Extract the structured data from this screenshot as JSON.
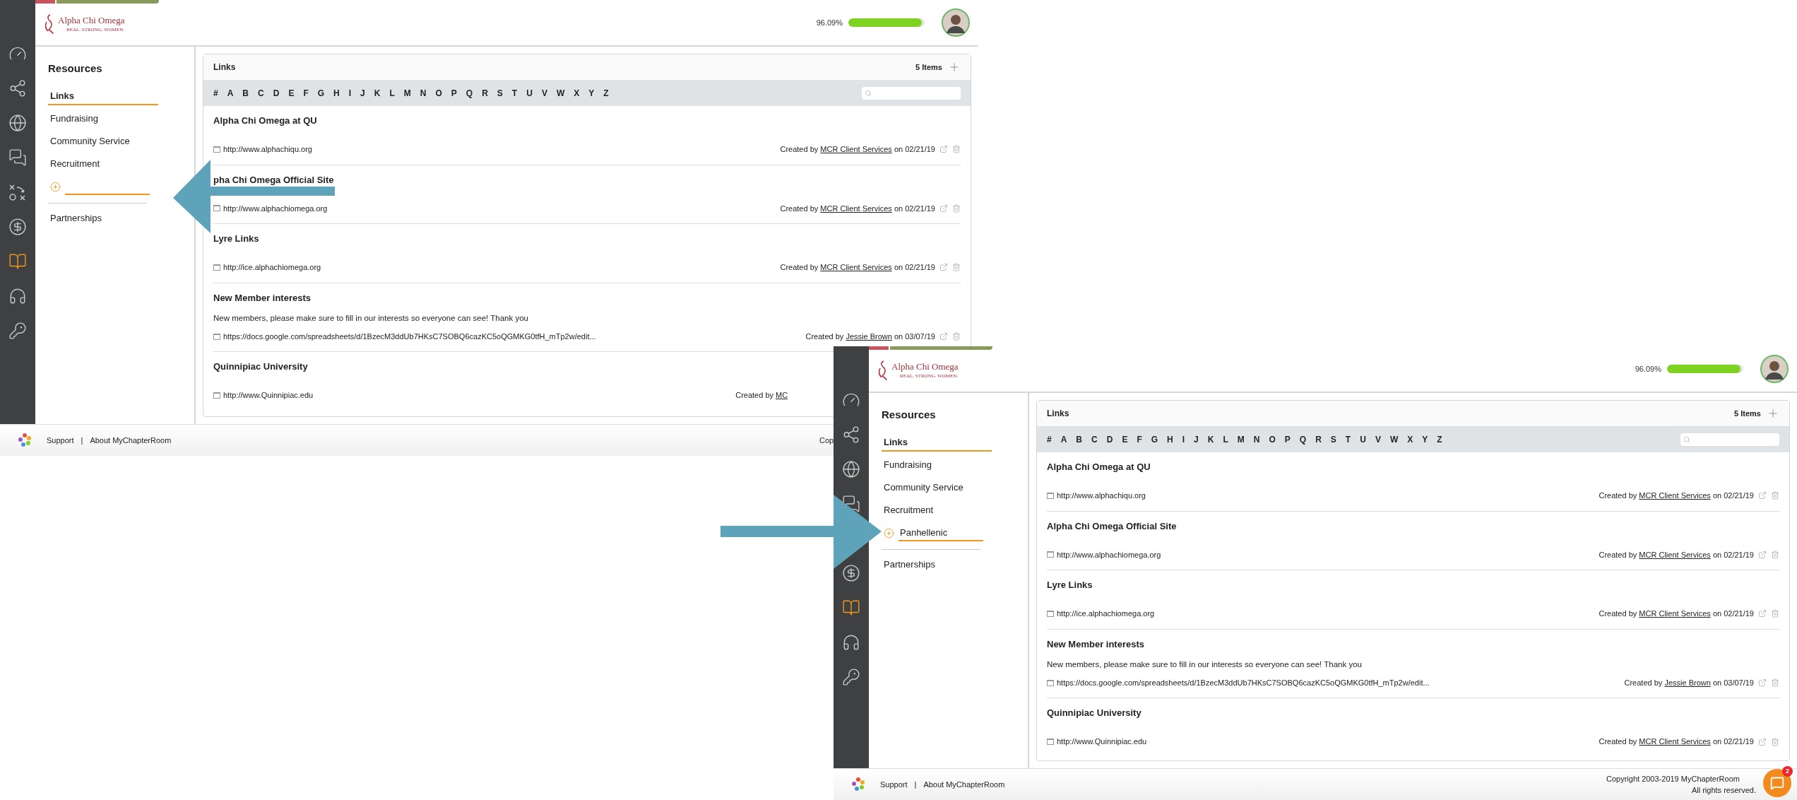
{
  "screens": [
    {
      "logo": {
        "name": "Alpha Chi Omega",
        "tagline": "REAL. STRONG. WOMEN."
      },
      "progress": {
        "reading": "96.09%",
        "level": 0.96
      },
      "nav": {
        "title": "Resources",
        "items": [
          {
            "kind": "item",
            "label": "Links",
            "selected": true
          },
          {
            "kind": "item",
            "label": "Fundraising",
            "selected": false
          },
          {
            "kind": "item",
            "label": "Community Service",
            "selected": false
          },
          {
            "kind": "item",
            "label": "Recruitment",
            "selected": false
          },
          {
            "kind": "input"
          },
          {
            "kind": "divider"
          },
          {
            "kind": "item",
            "label": "Partnerships",
            "selected": false
          }
        ]
      },
      "links": {
        "title": "Links",
        "count": "5 Items",
        "letters": [
          "#",
          "A",
          "B",
          "C",
          "D",
          "E",
          "F",
          "G",
          "H",
          "I",
          "J",
          "K",
          "L",
          "M",
          "N",
          "O",
          "P",
          "Q",
          "R",
          "S",
          "T",
          "U",
          "V",
          "W",
          "X",
          "Y",
          "Z"
        ],
        "rows": [
          {
            "title": "Alpha Chi Omega at QU",
            "url": "http://www.alphachiqu.org",
            "created": "Created by",
            "author": "MCR Client Services",
            "date": "on 02/21/19"
          },
          {
            "title": "pha Chi Omega Official Site",
            "url": "http://www.alphachiomega.org",
            "created": "Created by",
            "author": "MCR Client Services",
            "date": "on 02/21/19"
          },
          {
            "title": "Lyre Links",
            "url": "http://ice.alphachiomega.org",
            "created": "Created by",
            "author": "MCR Client Services",
            "date": "on 02/21/19"
          },
          {
            "title": "New Member interests",
            "description": "New members, please make sure to fill in our interests so everyone can see! Thank you",
            "url": "https://docs.google.com/spreadsheets/d/1BzecM3ddUb7HKsC7SOBQ6cazKC5oQGMKG0tfH_mTp2w/edit...",
            "created": "Created by",
            "author": "Jessie Brown",
            "date": "on 03/07/19"
          },
          {
            "title": "Quinnipiac University",
            "url": "http://www.Quinnipiac.edu",
            "created": "Created by",
            "author": "MC"
          }
        ]
      },
      "footer": {
        "links": [
          "Support",
          "About MyChapterRoom"
        ],
        "separator": "|",
        "copyright": [
          "Cop"
        ]
      }
    },
    {
      "logo": {
        "name": "Alpha Chi Omega",
        "tagline": "REAL. STRONG. WOMEN."
      },
      "progress": {
        "reading": "96.09%",
        "level": 0.96
      },
      "nav": {
        "title": "Resources",
        "items": [
          {
            "kind": "item",
            "label": "Links",
            "selected": true
          },
          {
            "kind": "item",
            "label": "Fundraising",
            "selected": false
          },
          {
            "kind": "item",
            "label": "Community Service",
            "selected": false
          },
          {
            "kind": "item",
            "label": "Recruitment",
            "selected": false
          },
          {
            "kind": "input",
            "value": "Panhellenic"
          },
          {
            "kind": "divider"
          },
          {
            "kind": "item",
            "label": "Partnerships",
            "selected": false
          }
        ]
      },
      "links": {
        "title": "Links",
        "count": "5 Items",
        "letters": [
          "#",
          "A",
          "B",
          "C",
          "D",
          "E",
          "F",
          "G",
          "H",
          "I",
          "J",
          "K",
          "L",
          "M",
          "N",
          "O",
          "P",
          "Q",
          "R",
          "S",
          "T",
          "U",
          "V",
          "W",
          "X",
          "Y",
          "Z"
        ],
        "rows": [
          {
            "title": "Alpha Chi Omega at QU",
            "url": "http://www.alphachiqu.org",
            "created": "Created by",
            "author": "MCR Client Services",
            "date": "on 02/21/19"
          },
          {
            "title": "Alpha Chi Omega Official Site",
            "url": "http://www.alphachiomega.org",
            "created": "Created by",
            "author": "MCR Client Services",
            "date": "on 02/21/19"
          },
          {
            "title": "Lyre Links",
            "url": "http://ice.alphachiomega.org",
            "created": "Created by",
            "author": "MCR Client Services",
            "date": "on 02/21/19"
          },
          {
            "title": "New Member interests",
            "description": "New members, please make sure to fill in our interests so everyone can see! Thank you",
            "url": "https://docs.google.com/spreadsheets/d/1BzecM3ddUb7HKsC7SOBQ6cazKC5oQGMKG0tfH_mTp2w/edit...",
            "created": "Created by",
            "author": "Jessie Brown",
            "date": "on 03/07/19"
          },
          {
            "title": "Quinnipiac University",
            "url": "http://www.Quinnipiac.edu",
            "created": "Created by",
            "author": "MCR Client Services",
            "date": "on 02/21/19"
          }
        ]
      },
      "footer": {
        "links": [
          "Support",
          "About MyChapterRoom"
        ],
        "separator": "|",
        "copyright": [
          "Copyright 2003-2019 MyChapterRoom",
          "All rights reserved."
        ]
      },
      "chat": {
        "badge": "2"
      }
    }
  ]
}
